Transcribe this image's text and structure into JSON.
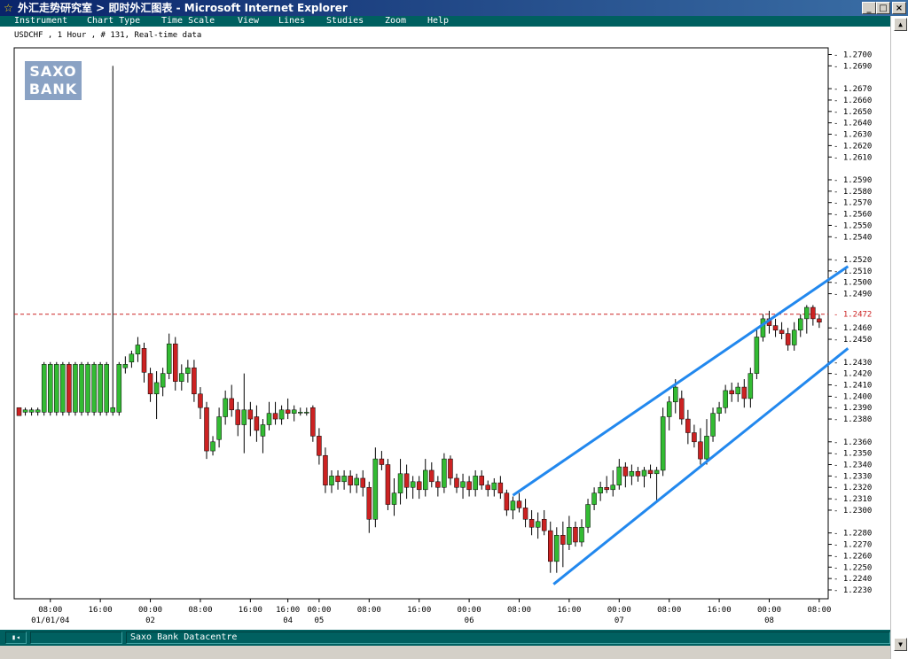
{
  "window": {
    "star": "☆",
    "title": "外汇走势研究室 > 即时外汇图表 - Microsoft Internet Explorer",
    "btn_min": "_",
    "btn_max": "□",
    "btn_close": "×"
  },
  "menu": {
    "items": [
      "Instrument",
      "Chart Type",
      "Time Scale",
      "View",
      "Lines",
      "Studies",
      "Zoom",
      "Help"
    ]
  },
  "info_line": "USDCHF , 1 Hour , # 131, Real-time data",
  "logo": {
    "line1": "SAXO",
    "line2": "BANK"
  },
  "status": {
    "text": "Saxo Bank Datacentre"
  },
  "colors": {
    "up": "#33bb33",
    "down": "#cc2222",
    "channel": "#2288ee",
    "current_price": "#cc2222",
    "menu_bg": "#006060"
  },
  "chart_data": {
    "type": "candlestick",
    "instrument": "USDCHF",
    "timeframe": "1 Hour",
    "ylim": [
      1.2225,
      1.2705
    ],
    "y_ticks": [
      "1.2700",
      "1.2690",
      "1.2670",
      "1.2660",
      "1.2650",
      "1.2640",
      "1.2630",
      "1.2620",
      "1.2610",
      "1.2590",
      "1.2580",
      "1.2570",
      "1.2560",
      "1.2550",
      "1.2540",
      "1.2520",
      "1.2510",
      "1.2500",
      "1.2490",
      "1.2460",
      "1.2450",
      "1.2430",
      "1.2420",
      "1.2410",
      "1.2400",
      "1.2390",
      "1.2380",
      "1.2360",
      "1.2350",
      "1.2340",
      "1.2330",
      "1.2320",
      "1.2310",
      "1.2300",
      "1.2280",
      "1.2270",
      "1.2260",
      "1.2250",
      "1.2240",
      "1.2230"
    ],
    "current_price": "1.2472",
    "x_ticks": [
      {
        "label": "08:00",
        "sub": "01/01/04",
        "idx": 5
      },
      {
        "label": "16:00",
        "sub": "",
        "idx": 13
      },
      {
        "label": "00:00",
        "sub": "02",
        "idx": 21
      },
      {
        "label": "08:00",
        "sub": "",
        "idx": 29
      },
      {
        "label": "16:00",
        "sub": "",
        "idx": 37
      },
      {
        "label": "16:00",
        "sub": "04",
        "idx": 43
      },
      {
        "label": "00:00",
        "sub": "05",
        "idx": 48
      },
      {
        "label": "08:00",
        "sub": "",
        "idx": 56
      },
      {
        "label": "16:00",
        "sub": "",
        "idx": 64
      },
      {
        "label": "00:00",
        "sub": "06",
        "idx": 72
      },
      {
        "label": "08:00",
        "sub": "",
        "idx": 80
      },
      {
        "label": "16:00",
        "sub": "",
        "idx": 88
      },
      {
        "label": "00:00",
        "sub": "07",
        "idx": 96
      },
      {
        "label": "08:00",
        "sub": "",
        "idx": 104
      },
      {
        "label": "16:00",
        "sub": "",
        "idx": 112
      },
      {
        "label": "00:00",
        "sub": "08",
        "idx": 120
      },
      {
        "label": "08:00",
        "sub": "",
        "idx": 128
      }
    ],
    "trend_lines": [
      {
        "name": "upper",
        "x1": 79,
        "y1": 1.2313,
        "x2": 132.6,
        "y2": 1.2514
      },
      {
        "name": "lower",
        "x1": 85.5,
        "y1": 1.2235,
        "x2": 132.6,
        "y2": 1.2442
      }
    ],
    "candles": [
      [
        1.239,
        1.239,
        1.2383,
        1.2383
      ],
      [
        1.2386,
        1.239,
        1.2383,
        1.2388
      ],
      [
        1.2386,
        1.239,
        1.2383,
        1.2388
      ],
      [
        1.2386,
        1.239,
        1.2383,
        1.2388
      ],
      [
        1.2386,
        1.243,
        1.2383,
        1.2428
      ],
      [
        1.2386,
        1.243,
        1.2383,
        1.2428
      ],
      [
        1.2386,
        1.243,
        1.2383,
        1.2428
      ],
      [
        1.2386,
        1.243,
        1.2383,
        1.2428
      ],
      [
        1.2428,
        1.243,
        1.2383,
        1.2386
      ],
      [
        1.2386,
        1.243,
        1.2383,
        1.2428
      ],
      [
        1.2386,
        1.243,
        1.2383,
        1.2428
      ],
      [
        1.2386,
        1.243,
        1.2383,
        1.2428
      ],
      [
        1.2386,
        1.243,
        1.2383,
        1.2428
      ],
      [
        1.2386,
        1.243,
        1.2383,
        1.2428
      ],
      [
        1.2386,
        1.243,
        1.2383,
        1.2428
      ],
      [
        1.2386,
        1.269,
        1.2383,
        1.239
      ],
      [
        1.2386,
        1.243,
        1.2383,
        1.2428
      ],
      [
        1.2425,
        1.2435,
        1.242,
        1.2428
      ],
      [
        1.243,
        1.244,
        1.2425,
        1.2437
      ],
      [
        1.2437,
        1.2452,
        1.243,
        1.2445
      ],
      [
        1.2442,
        1.2447,
        1.2412,
        1.2421
      ],
      [
        1.242,
        1.2425,
        1.2395,
        1.2402
      ],
      [
        1.2402,
        1.2422,
        1.238,
        1.2412
      ],
      [
        1.2408,
        1.2425,
        1.24,
        1.242
      ],
      [
        1.242,
        1.2455,
        1.2415,
        1.2446
      ],
      [
        1.2446,
        1.2452,
        1.2405,
        1.2413
      ],
      [
        1.2413,
        1.2428,
        1.2405,
        1.242
      ],
      [
        1.242,
        1.2432,
        1.2412,
        1.2425
      ],
      [
        1.2425,
        1.2432,
        1.2395,
        1.2402
      ],
      [
        1.2402,
        1.2408,
        1.238,
        1.239
      ],
      [
        1.239,
        1.2395,
        1.2345,
        1.2352
      ],
      [
        1.2352,
        1.2365,
        1.2348,
        1.236
      ],
      [
        1.2362,
        1.239,
        1.2355,
        1.2382
      ],
      [
        1.2382,
        1.2405,
        1.2375,
        1.2398
      ],
      [
        1.2398,
        1.241,
        1.2382,
        1.2388
      ],
      [
        1.2388,
        1.2395,
        1.2365,
        1.2375
      ],
      [
        1.2375,
        1.242,
        1.235,
        1.2388
      ],
      [
        1.2388,
        1.2395,
        1.2365,
        1.238
      ],
      [
        1.2382,
        1.2392,
        1.236,
        1.237
      ],
      [
        1.2365,
        1.238,
        1.235,
        1.2375
      ],
      [
        1.2375,
        1.2395,
        1.237,
        1.2385
      ],
      [
        1.2385,
        1.2395,
        1.2375,
        1.238
      ],
      [
        1.238,
        1.2392,
        1.2375,
        1.2388
      ],
      [
        1.2388,
        1.2398,
        1.238,
        1.2385
      ],
      [
        1.2385,
        1.2392,
        1.2378,
        1.2388
      ],
      [
        1.2386,
        1.239,
        1.2383,
        1.2386
      ],
      [
        1.2386,
        1.239,
        1.2383,
        1.2386
      ],
      [
        1.239,
        1.2392,
        1.236,
        1.2365
      ],
      [
        1.2365,
        1.2372,
        1.234,
        1.2348
      ],
      [
        1.2348,
        1.2355,
        1.2315,
        1.2322
      ],
      [
        1.2322,
        1.2335,
        1.2315,
        1.233
      ],
      [
        1.233,
        1.2335,
        1.2318,
        1.2325
      ],
      [
        1.2325,
        1.2335,
        1.2318,
        1.233
      ],
      [
        1.233,
        1.2335,
        1.2315,
        1.2322
      ],
      [
        1.2322,
        1.2332,
        1.2315,
        1.2328
      ],
      [
        1.2328,
        1.2335,
        1.2312,
        1.232
      ],
      [
        1.232,
        1.2325,
        1.228,
        1.2292
      ],
      [
        1.2292,
        1.2355,
        1.2285,
        1.2345
      ],
      [
        1.2345,
        1.2352,
        1.2335,
        1.234
      ],
      [
        1.234,
        1.2345,
        1.23,
        1.2305
      ],
      [
        1.2305,
        1.2328,
        1.2295,
        1.2315
      ],
      [
        1.2315,
        1.2345,
        1.2305,
        1.2332
      ],
      [
        1.2332,
        1.234,
        1.231,
        1.232
      ],
      [
        1.232,
        1.233,
        1.231,
        1.2325
      ],
      [
        1.2325,
        1.233,
        1.231,
        1.2318
      ],
      [
        1.2318,
        1.2345,
        1.2312,
        1.2335
      ],
      [
        1.2335,
        1.2342,
        1.232,
        1.2325
      ],
      [
        1.2325,
        1.233,
        1.2312,
        1.232
      ],
      [
        1.232,
        1.235,
        1.2315,
        1.2345
      ],
      [
        1.2345,
        1.2348,
        1.2322,
        1.2328
      ],
      [
        1.2328,
        1.2332,
        1.2315,
        1.232
      ],
      [
        1.232,
        1.2332,
        1.231,
        1.2325
      ],
      [
        1.2325,
        1.233,
        1.2312,
        1.2318
      ],
      [
        1.2318,
        1.2335,
        1.2312,
        1.233
      ],
      [
        1.233,
        1.2335,
        1.2318,
        1.2322
      ],
      [
        1.2322,
        1.2326,
        1.2312,
        1.2318
      ],
      [
        1.2318,
        1.2328,
        1.2312,
        1.2324
      ],
      [
        1.2324,
        1.233,
        1.231,
        1.2315
      ],
      [
        1.2315,
        1.2318,
        1.2295,
        1.23
      ],
      [
        1.23,
        1.2312,
        1.2292,
        1.2308
      ],
      [
        1.2308,
        1.2315,
        1.2298,
        1.2302
      ],
      [
        1.2302,
        1.231,
        1.2285,
        1.2292
      ],
      [
        1.2292,
        1.23,
        1.2278,
        1.2285
      ],
      [
        1.2285,
        1.2298,
        1.2275,
        1.229
      ],
      [
        1.2292,
        1.23,
        1.2278,
        1.2282
      ],
      [
        1.2282,
        1.229,
        1.2245,
        1.2255
      ],
      [
        1.2255,
        1.2285,
        1.2245,
        1.2278
      ],
      [
        1.2278,
        1.229,
        1.225,
        1.227
      ],
      [
        1.227,
        1.2295,
        1.2265,
        1.2285
      ],
      [
        1.2285,
        1.229,
        1.2268,
        1.2272
      ],
      [
        1.2272,
        1.2292,
        1.2268,
        1.2285
      ],
      [
        1.2285,
        1.231,
        1.228,
        1.2305
      ],
      [
        1.2305,
        1.232,
        1.23,
        1.2315
      ],
      [
        1.2315,
        1.2325,
        1.2308,
        1.232
      ],
      [
        1.232,
        1.233,
        1.2315,
        1.2318
      ],
      [
        1.2318,
        1.2335,
        1.2312,
        1.2322
      ],
      [
        1.2322,
        1.2345,
        1.2318,
        1.2338
      ],
      [
        1.2338,
        1.2342,
        1.232,
        1.233
      ],
      [
        1.233,
        1.234,
        1.2322,
        1.2334
      ],
      [
        1.2334,
        1.2338,
        1.2325,
        1.233
      ],
      [
        1.233,
        1.2338,
        1.232,
        1.2335
      ],
      [
        1.2335,
        1.234,
        1.2328,
        1.2332
      ],
      [
        1.2332,
        1.2338,
        1.2308,
        1.2335
      ],
      [
        1.2335,
        1.239,
        1.233,
        1.2382
      ],
      [
        1.2382,
        1.24,
        1.237,
        1.2395
      ],
      [
        1.2395,
        1.2415,
        1.2385,
        1.2408
      ],
      [
        1.2398,
        1.2405,
        1.2375,
        1.238
      ],
      [
        1.238,
        1.2388,
        1.2358,
        1.2368
      ],
      [
        1.2368,
        1.2375,
        1.2355,
        1.236
      ],
      [
        1.236,
        1.2372,
        1.234,
        1.2345
      ],
      [
        1.2345,
        1.238,
        1.234,
        1.2365
      ],
      [
        1.2365,
        1.239,
        1.236,
        1.2385
      ],
      [
        1.2385,
        1.2395,
        1.2378,
        1.239
      ],
      [
        1.239,
        1.241,
        1.2385,
        1.2405
      ],
      [
        1.2405,
        1.2412,
        1.2395,
        1.2402
      ],
      [
        1.2402,
        1.2412,
        1.2395,
        1.2408
      ],
      [
        1.2408,
        1.2415,
        1.239,
        1.2398
      ],
      [
        1.2398,
        1.2425,
        1.239,
        1.242
      ],
      [
        1.242,
        1.246,
        1.2415,
        1.2452
      ],
      [
        1.2452,
        1.2472,
        1.2448,
        1.2468
      ],
      [
        1.2468,
        1.2475,
        1.2455,
        1.2462
      ],
      [
        1.2462,
        1.2468,
        1.2452,
        1.2458
      ],
      [
        1.2458,
        1.2465,
        1.245,
        1.2455
      ],
      [
        1.2455,
        1.246,
        1.244,
        1.2445
      ],
      [
        1.2445,
        1.2465,
        1.244,
        1.2458
      ],
      [
        1.2458,
        1.2472,
        1.2452,
        1.2468
      ],
      [
        1.2468,
        1.248,
        1.2455,
        1.2478
      ],
      [
        1.2478,
        1.248,
        1.2462,
        1.2468
      ],
      [
        1.2468,
        1.2472,
        1.246,
        1.2465
      ]
    ]
  }
}
